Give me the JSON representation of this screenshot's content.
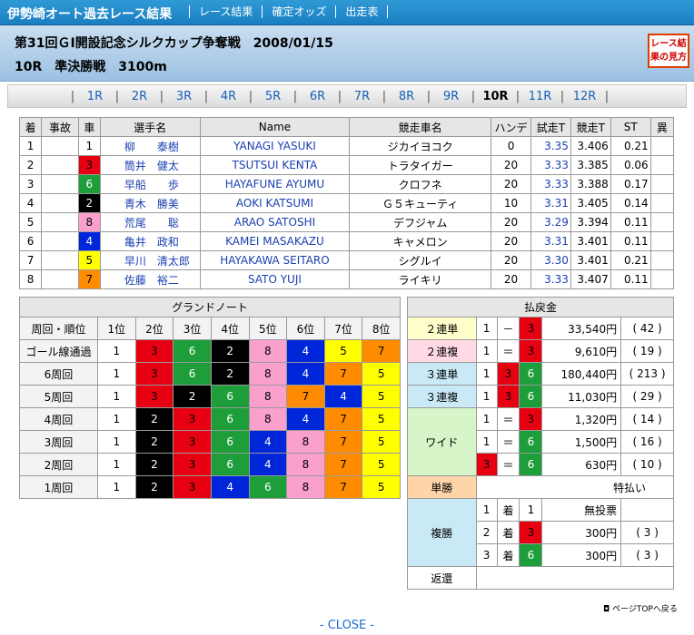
{
  "site_title": "伊勢崎オート過去レース結果",
  "nav": [
    "レース結果",
    "確定オッズ",
    "出走表"
  ],
  "race": {
    "title": "第31回ＧⅠ開設記念シルクカップ争奪戦　2008/01/15",
    "sub": "10R　準決勝戦　3100m"
  },
  "guide_button": "レース結果の見方",
  "rounds": [
    "1R",
    "2R",
    "3R",
    "4R",
    "5R",
    "6R",
    "7R",
    "8R",
    "9R",
    "10R",
    "11R",
    "12R"
  ],
  "current_round": "10R",
  "main_headers": [
    "着",
    "事故",
    "車",
    "選手名",
    "Name",
    "競走車名",
    "ハンデ",
    "試走T",
    "競走T",
    "ST",
    "異"
  ],
  "entries": [
    {
      "pos": "1",
      "acc": "",
      "car": "1",
      "name": "柳　　泰樹",
      "roman": "YANAGI YASUKI",
      "machine": "ジカイヨコク",
      "handi": "0",
      "trial": "3.35",
      "race_t": "3.406",
      "st": "0.21",
      "ab": ""
    },
    {
      "pos": "2",
      "acc": "",
      "car": "3",
      "name": "筒井　健太",
      "roman": "TSUTSUI KENTA",
      "machine": "トラタイガー",
      "handi": "20",
      "trial": "3.33",
      "race_t": "3.385",
      "st": "0.06",
      "ab": ""
    },
    {
      "pos": "3",
      "acc": "",
      "car": "6",
      "name": "早船　　歩",
      "roman": "HAYAFUNE AYUMU",
      "machine": "クロフネ",
      "handi": "20",
      "trial": "3.33",
      "race_t": "3.388",
      "st": "0.17",
      "ab": ""
    },
    {
      "pos": "4",
      "acc": "",
      "car": "2",
      "name": "青木　勝美",
      "roman": "AOKI KATSUMI",
      "machine": "Ｇ５キューティ",
      "handi": "10",
      "trial": "3.31",
      "race_t": "3.405",
      "st": "0.14",
      "ab": ""
    },
    {
      "pos": "5",
      "acc": "",
      "car": "8",
      "name": "荒尾　　聡",
      "roman": "ARAO SATOSHI",
      "machine": "デフジャム",
      "handi": "20",
      "trial": "3.29",
      "race_t": "3.394",
      "st": "0.11",
      "ab": ""
    },
    {
      "pos": "6",
      "acc": "",
      "car": "4",
      "name": "亀井　政和",
      "roman": "KAMEI MASAKAZU",
      "machine": "キャメロン",
      "handi": "20",
      "trial": "3.31",
      "race_t": "3.401",
      "st": "0.11",
      "ab": ""
    },
    {
      "pos": "7",
      "acc": "",
      "car": "5",
      "name": "早川　清太郎",
      "roman": "HAYAKAWA SEITARO",
      "machine": "シグルイ",
      "handi": "20",
      "trial": "3.30",
      "race_t": "3.401",
      "st": "0.21",
      "ab": ""
    },
    {
      "pos": "8",
      "acc": "",
      "car": "7",
      "name": "佐藤　裕二",
      "roman": "SATO YUJI",
      "machine": "ライキリ",
      "handi": "20",
      "trial": "3.33",
      "race_t": "3.407",
      "st": "0.11",
      "ab": ""
    }
  ],
  "grand": {
    "title": "グランドノート",
    "headers": [
      "周回・順位",
      "1位",
      "2位",
      "3位",
      "4位",
      "5位",
      "6位",
      "7位",
      "8位"
    ],
    "rows": [
      {
        "label": "ゴール線通過",
        "cars": [
          "1",
          "3",
          "6",
          "2",
          "8",
          "4",
          "5",
          "7"
        ]
      },
      {
        "label": "6周回",
        "cars": [
          "1",
          "3",
          "6",
          "2",
          "8",
          "4",
          "7",
          "5"
        ]
      },
      {
        "label": "5周回",
        "cars": [
          "1",
          "3",
          "2",
          "6",
          "8",
          "7",
          "4",
          "5"
        ]
      },
      {
        "label": "4周回",
        "cars": [
          "1",
          "2",
          "3",
          "6",
          "8",
          "4",
          "7",
          "5"
        ]
      },
      {
        "label": "3周回",
        "cars": [
          "1",
          "2",
          "3",
          "6",
          "4",
          "8",
          "7",
          "5"
        ]
      },
      {
        "label": "2周回",
        "cars": [
          "1",
          "2",
          "3",
          "6",
          "4",
          "8",
          "7",
          "5"
        ]
      },
      {
        "label": "1周回",
        "cars": [
          "1",
          "2",
          "3",
          "4",
          "6",
          "8",
          "7",
          "5"
        ]
      }
    ]
  },
  "payout": {
    "title": "払戻金",
    "exacta": {
      "label": "２連単",
      "c1": "1",
      "sep": "－",
      "c2": "3",
      "amount": "33,540円",
      "pop": "( 42 )"
    },
    "quinella": {
      "label": "２連複",
      "c1": "1",
      "sep": "＝",
      "c2": "3",
      "amount": "9,610円",
      "pop": "( 19 )"
    },
    "trifecta": {
      "label": "３連単",
      "c1": "1",
      "c2": "3",
      "c3": "6",
      "amount": "180,440円",
      "pop": "( 213 )"
    },
    "trio": {
      "label": "３連複",
      "c1": "1",
      "c2": "3",
      "c3": "6",
      "amount": "11,030円",
      "pop": "( 29 )"
    },
    "wide": {
      "label": "ワイド",
      "rows": [
        {
          "c1": "1",
          "sep": "＝",
          "c2": "3",
          "amount": "1,320円",
          "pop": "( 14 )"
        },
        {
          "c1": "1",
          "sep": "＝",
          "c2": "6",
          "amount": "1,500円",
          "pop": "( 16 )"
        },
        {
          "c1": "3",
          "sep": "＝",
          "c2": "6",
          "amount": "630円",
          "pop": "( 10 )"
        }
      ]
    },
    "win": {
      "label": "単勝",
      "text": "特払い"
    },
    "place": {
      "label": "複勝",
      "chaku": "着",
      "rows": [
        {
          "rank": "1",
          "car": "1",
          "amount": "無投票",
          "pop": ""
        },
        {
          "rank": "2",
          "car": "3",
          "amount": "300円",
          "pop": "( 3 )"
        },
        {
          "rank": "3",
          "car": "6",
          "amount": "300円",
          "pop": "( 3 )"
        }
      ]
    },
    "refund": {
      "label": "返還"
    }
  },
  "page_top": "ページTOPへ戻る",
  "close": "- CLOSE -"
}
